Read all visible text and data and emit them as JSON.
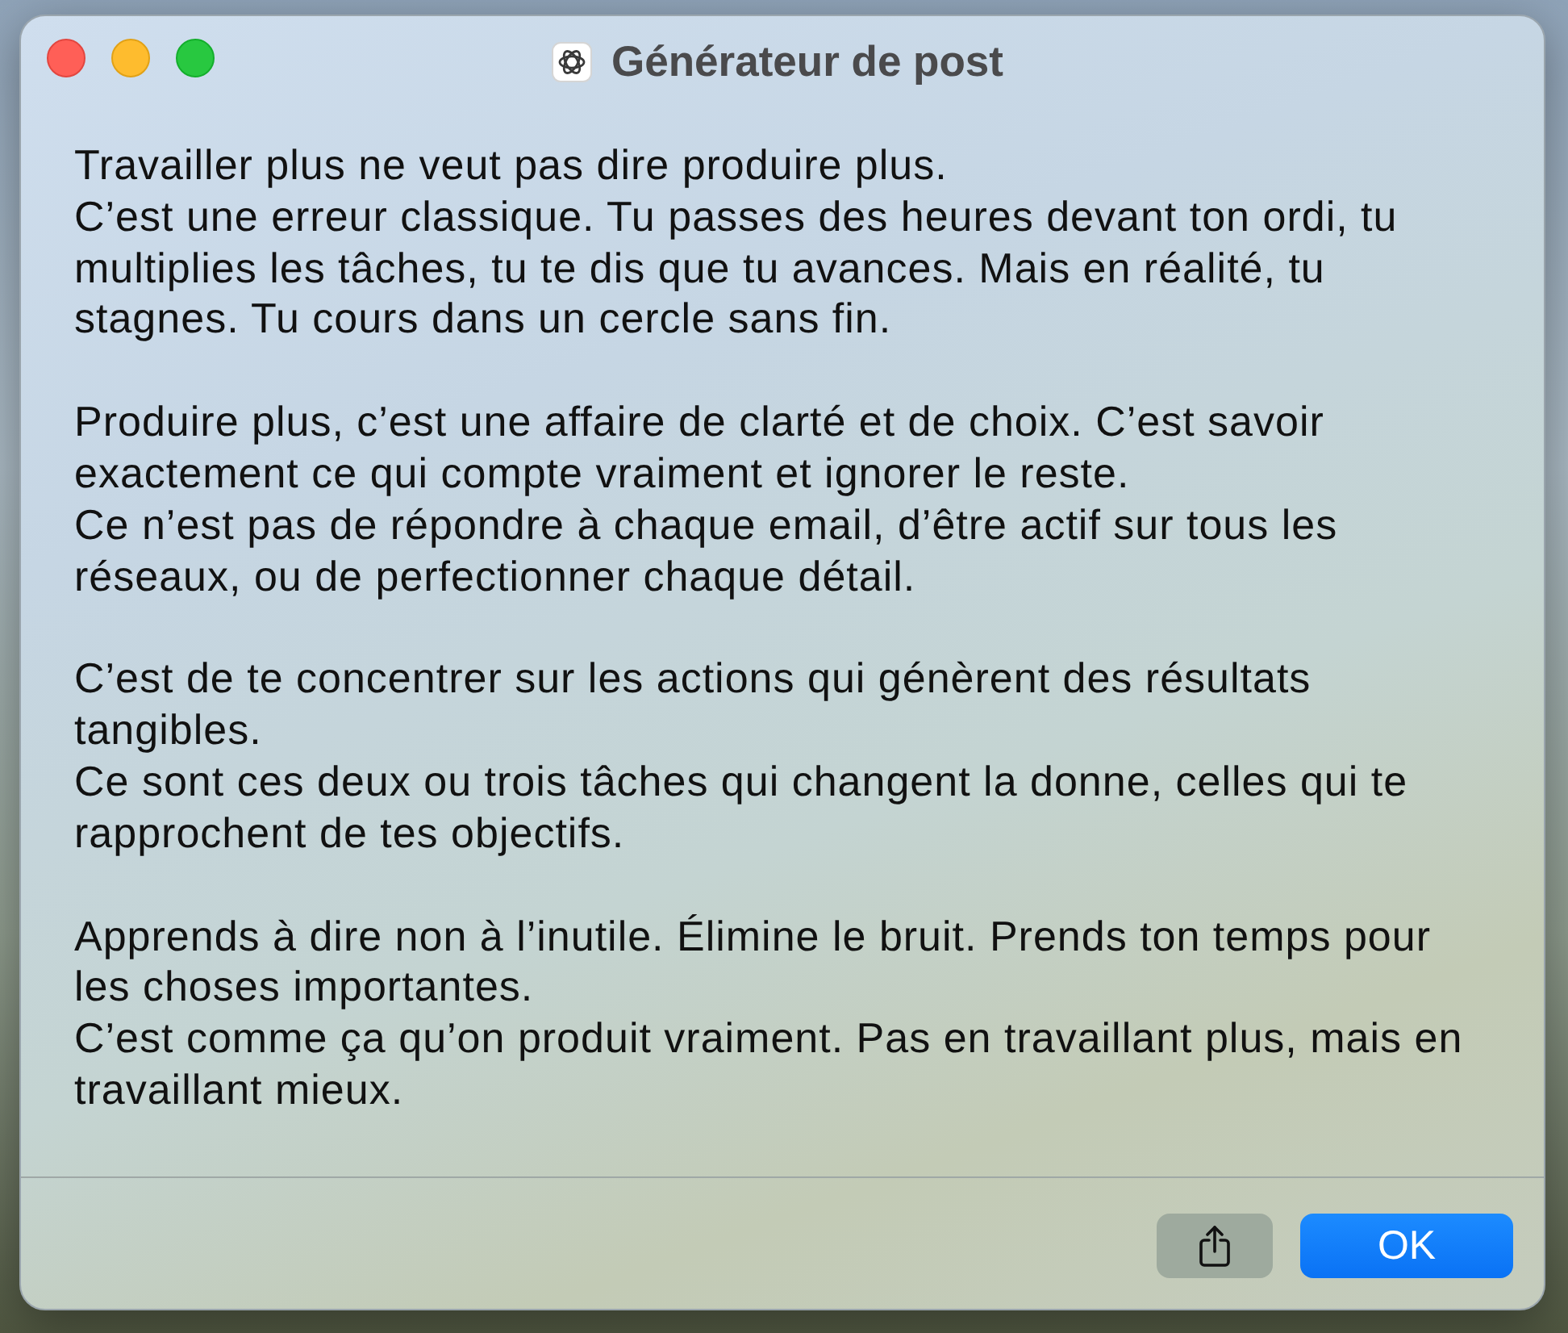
{
  "window": {
    "title": "Générateur de post",
    "controls": [
      {
        "kind": "close"
      },
      {
        "kind": "minimize"
      },
      {
        "kind": "zoom"
      }
    ]
  },
  "post": {
    "paragraphs": [
      [
        "Travailler plus ne veut pas dire produire plus.",
        "C’est une erreur classique. Tu passes des heures devant ton ordi, tu multiplies les tâches, tu te dis que tu avances. Mais en réalité, tu stagnes. Tu cours dans un cercle sans fin."
      ],
      [
        "Produire plus, c’est une affaire de clarté et de choix. C’est savoir exactement ce qui compte vraiment et ignorer le reste.",
        "Ce n’est pas de répondre à chaque email, d’être actif sur tous les réseaux, ou de perfectionner chaque détail."
      ],
      [
        "C’est de te concentrer sur les actions qui génèrent des résultats tangibles.",
        "Ce sont ces deux ou trois tâches qui changent la donne, celles qui te rapprochent de tes objectifs."
      ],
      [
        "Apprends à dire non à l’inutile. Élimine le bruit. Prends ton temps pour les choses importantes.",
        "C’est comme ça qu’on produit vraiment. Pas en travaillant plus, mais en travaillant mieux."
      ]
    ]
  },
  "buttons": [
    {
      "kind": "share"
    },
    {
      "kind": "primary",
      "label": "OK"
    }
  ]
}
